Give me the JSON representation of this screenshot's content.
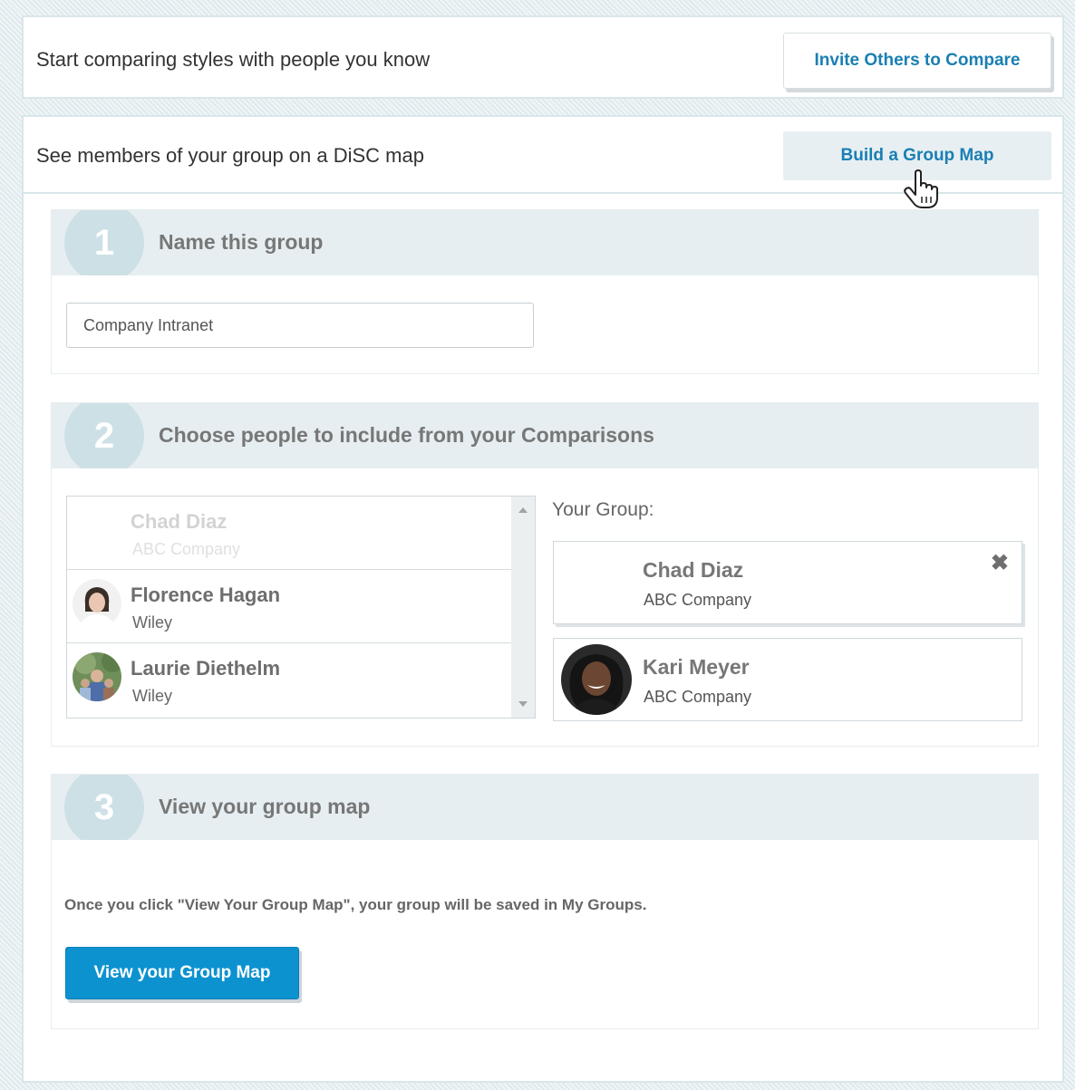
{
  "invite_panel": {
    "title": "Start comparing styles with people you know",
    "button_label": "Invite Others to Compare"
  },
  "group_panel": {
    "title": "See members of your group on a DiSC map",
    "button_label": "Build a Group Map"
  },
  "step1": {
    "number": "1",
    "title": "Name this group",
    "input_value": "Company Intranet"
  },
  "step2": {
    "number": "2",
    "title": "Choose people to include from your Comparisons",
    "comparisons": [
      {
        "name": "Chad Diaz",
        "company": "ABC Company"
      },
      {
        "name": "Florence Hagan",
        "company": "Wiley"
      },
      {
        "name": "Laurie Diethelm",
        "company": "Wiley"
      }
    ],
    "your_group_label": "Your Group:",
    "group_members": [
      {
        "name": "Chad Diaz",
        "company": "ABC Company"
      },
      {
        "name": "Kari Meyer",
        "company": "ABC Company"
      }
    ],
    "remove_symbol": "✖"
  },
  "step3": {
    "number": "3",
    "title": "View your group map",
    "note": "Once you click \"View Your Group Map\", your group will be saved in My Groups.",
    "button_label": "View your Group Map"
  },
  "colors": {
    "accent_blue": "#0d92d0",
    "link_blue": "#1a7fb3",
    "step_header_bg": "#e6eef1",
    "step_circle": "#cde0e6"
  },
  "icons": [
    "hand-pointer-icon",
    "close-icon",
    "scroll-up-icon",
    "scroll-down-icon"
  ]
}
